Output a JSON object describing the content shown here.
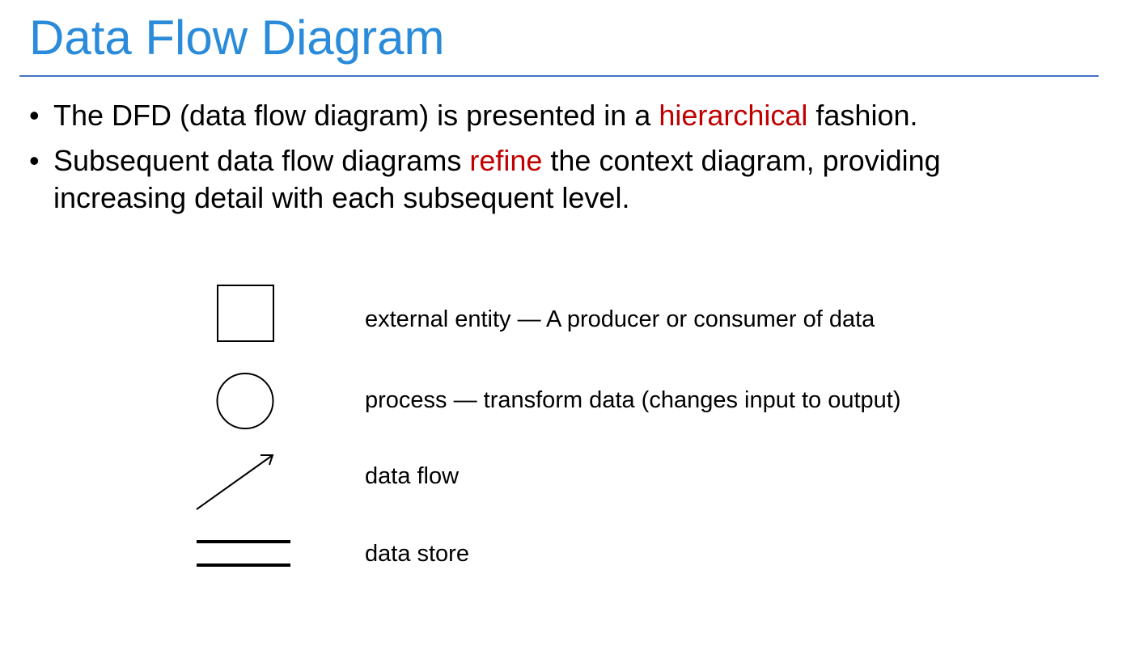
{
  "slide": {
    "title": "Data Flow Diagram",
    "bullets": [
      {
        "pre": "The DFD (data flow diagram) is presented in a ",
        "highlight": "hierarchical",
        "post": " fashion."
      },
      {
        "pre": "Subsequent data flow diagrams ",
        "highlight": "refine",
        "post": " the context diagram, providing increasing detail with each subsequent level."
      }
    ]
  },
  "legend": {
    "items": [
      {
        "icon": "square-icon",
        "label": "external entity — A producer or consumer of data"
      },
      {
        "icon": "circle-icon",
        "label": "process — transform data (changes input to output)"
      },
      {
        "icon": "arrow-icon",
        "label": "data flow"
      },
      {
        "icon": "double-line-icon",
        "label": "data store"
      }
    ]
  },
  "colors": {
    "title": "#2A8BDB",
    "rule": "#4472C4",
    "highlight": "#C00000",
    "text": "#000000"
  }
}
